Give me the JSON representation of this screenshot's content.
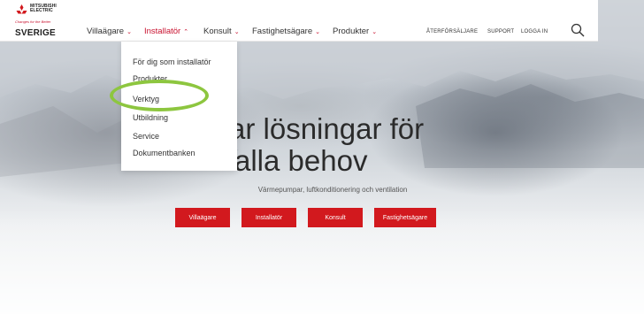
{
  "brand": {
    "name_line1": "MITSUBISHI",
    "name_line2": "ELECTRIC",
    "tagline": "Changes for the Better",
    "country": "SVERIGE",
    "color": "#d2191e"
  },
  "nav": {
    "items": [
      {
        "label": "Villaägare",
        "chevron": "⌄"
      },
      {
        "label": "Installatör",
        "chevron": "⌃"
      },
      {
        "label": "Konsult",
        "chevron": "⌄"
      },
      {
        "label": "Fastighetsägare",
        "chevron": "⌄"
      },
      {
        "label": "Produkter",
        "chevron": "⌄"
      }
    ],
    "utility": [
      "ÅTERFÖRSÄLJARE",
      "SUPPORT",
      "LOGGA IN"
    ],
    "search_icon": "search-icon"
  },
  "dropdown": {
    "items": [
      "För dig som installatör",
      "Produkter",
      "Verktyg",
      "Utbildning",
      "Service",
      "Dokumentbanken"
    ]
  },
  "hero": {
    "line1": "ar lösningar för",
    "line2": "alla behov",
    "subtitle": "Värmepumpar, luftkonditionering och ventilation",
    "buttons": [
      "Villaägare",
      "Installatör",
      "Konsult",
      "Fastighetsägare"
    ]
  },
  "colors": {
    "accent_red": "#d2191e",
    "highlight_ring": "#8dc63f"
  }
}
